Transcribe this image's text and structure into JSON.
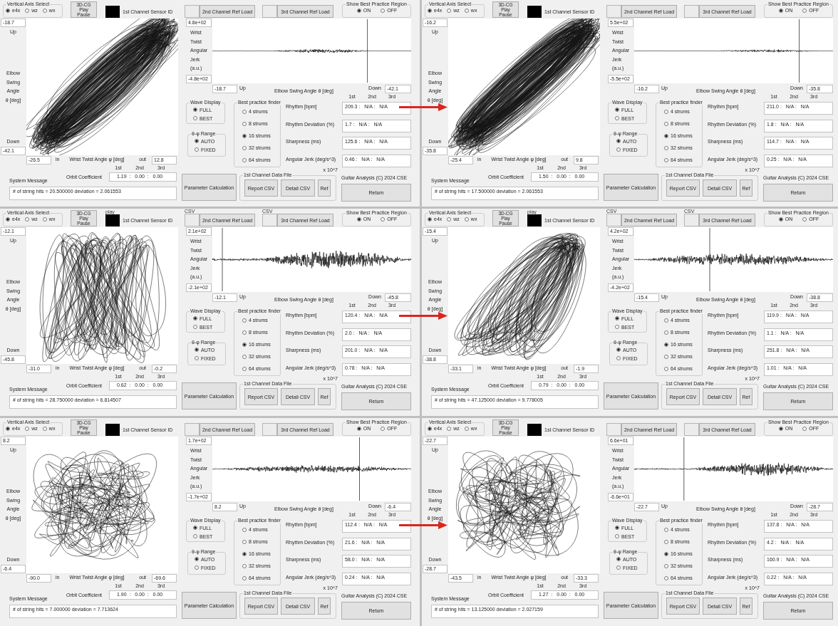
{
  "panels": [
    {
      "axis_select": {
        "title": "Vertical Axis Select",
        "options": [
          {
            "label": "e4x",
            "selected": true
          },
          {
            "label": "wz",
            "selected": false
          },
          {
            "label": "wx",
            "selected": false
          }
        ]
      },
      "play_button": [
        "3D-CG",
        "Play",
        "Pause"
      ],
      "sensor": {
        "label": "1st Channel Sensor ID"
      },
      "ref_loads": [
        {
          "label": "2nd Channel Ref Load"
        },
        {
          "label": "3rd Channel Ref Load"
        }
      ],
      "best_region": {
        "title": "Show Best Practice Region",
        "options": [
          {
            "label": "ON",
            "selected": true
          },
          {
            "label": "OFF",
            "selected": false
          }
        ]
      },
      "orbit_plot": {
        "kind": "ellipse",
        "up_value": "-18.7",
        "up_label": "Up",
        "y_label": [
          "Elbow",
          "Swing",
          "Angle",
          "θ [deg]"
        ],
        "down_label": "Down",
        "down_value": "-42.1",
        "in_value": "-26.5",
        "in_label": "in",
        "x_label": "Wrist Twist Angle φ [deg]",
        "out_label": "out",
        "out_value": "12.8"
      },
      "jerk_plot": {
        "max_value": "4.8e+02",
        "y_label": [
          "Wrist",
          "Twist",
          "Angular",
          "Jerk",
          "(a.u.)"
        ],
        "min_value": "-4.8e+02",
        "up_value": "-18.7",
        "up_label": "Up",
        "x_label": "Elbow Swing Angle θ [deg]",
        "down_label": "Down",
        "down_value": "-42.1"
      },
      "result_headers": [
        "1st",
        "2nd",
        "3rd"
      ],
      "wave_display": {
        "title": "Wave Display",
        "options": [
          {
            "label": "FULL",
            "selected": true
          },
          {
            "label": "BEST",
            "selected": false
          }
        ]
      },
      "range": {
        "title": "θ-φ Range",
        "options": [
          {
            "label": "AUTO",
            "selected": true
          },
          {
            "label": "FIXED",
            "selected": false
          }
        ]
      },
      "finder": {
        "title": "Best practice finder",
        "options": [
          {
            "label": "4 strums",
            "selected": false
          },
          {
            "label": "8 strums",
            "selected": false
          },
          {
            "label": "16 strums",
            "selected": true
          },
          {
            "label": "32 strums",
            "selected": false
          },
          {
            "label": "64 strums",
            "selected": false
          }
        ]
      },
      "results": [
        {
          "label": "Rhythm [bpm]",
          "value": "209.3 :   N/A :   N/A"
        },
        {
          "label": "Rhythm Deviation (%)",
          "value": "1.7 :   N/A :   N/A"
        },
        {
          "label": "Sharpness (ms)",
          "value": "125.6 :   N/A :   N/A"
        },
        {
          "label": "Angular Jerk (deg/s^3)",
          "value": "0.46 :   N/A :   N/A"
        }
      ],
      "jerk_scale": "x 10^7",
      "orbit_coefficient": {
        "headers": [
          "1st",
          "2nd",
          "3rd"
        ],
        "label": "Orbit Coefficient",
        "value": "1.19  :   0.00  :   0.00"
      },
      "system_message": {
        "label": "System Message",
        "text": "# of string hits = 20.500000 deviation = 2.061553"
      },
      "parameter_button": "Parameter Calculation",
      "data_file": {
        "title": "1st Channel Data File",
        "buttons": [
          "Report CSV",
          "Detail CSV",
          "Ref"
        ]
      },
      "copyright": "Guitar Analysis (C) 2024 CSE",
      "return_button": "Return"
    },
    {
      "axis_select": {
        "title": "Vertical Axis Select",
        "options": [
          {
            "label": "e4x",
            "selected": true
          },
          {
            "label": "wz",
            "selected": false
          },
          {
            "label": "wx",
            "selected": false
          }
        ]
      },
      "play_button": [
        "3D-CG",
        "Play",
        "Pause"
      ],
      "sensor": {
        "label": "1st Channel Sensor ID"
      },
      "ref_loads": [
        {
          "label": "2nd Channel Ref Load"
        },
        {
          "label": "3rd Channel Ref Load"
        }
      ],
      "best_region": {
        "title": "Show Best Practice Region",
        "options": [
          {
            "label": "ON",
            "selected": true
          },
          {
            "label": "OFF",
            "selected": false
          }
        ]
      },
      "orbit_plot": {
        "kind": "ellipse",
        "up_value": "-16.2",
        "up_label": "Up",
        "y_label": [
          "Elbow",
          "Swing",
          "Angle",
          "θ [deg]"
        ],
        "down_label": "Down",
        "down_value": "-35.8",
        "in_value": "-25.4",
        "in_label": "in",
        "x_label": "Wrist Twist Angle φ [deg]",
        "out_label": "out",
        "out_value": "9.8"
      },
      "jerk_plot": {
        "max_value": "5.5e+02",
        "y_label": [
          "Wrist",
          "Twist",
          "Angular",
          "Jerk",
          "(a.u.)"
        ],
        "min_value": "-5.5e+02",
        "up_value": "-16.2",
        "up_label": "Up",
        "x_label": "Elbow Swing Angle θ [deg]",
        "down_label": "Down",
        "down_value": "-35.8"
      },
      "result_headers": [
        "1st",
        "2nd",
        "3rd"
      ],
      "wave_display": {
        "title": "Wave Display",
        "options": [
          {
            "label": "FULL",
            "selected": true
          },
          {
            "label": "BEST",
            "selected": false
          }
        ]
      },
      "range": {
        "title": "θ-φ Range",
        "options": [
          {
            "label": "AUTO",
            "selected": true
          },
          {
            "label": "FIXED",
            "selected": false
          }
        ]
      },
      "finder": {
        "title": "Best practice finder",
        "options": [
          {
            "label": "4 strums",
            "selected": false
          },
          {
            "label": "8 strums",
            "selected": false
          },
          {
            "label": "16 strums",
            "selected": true
          },
          {
            "label": "32 strums",
            "selected": false
          },
          {
            "label": "64 strums",
            "selected": false
          }
        ]
      },
      "results": [
        {
          "label": "Rhythm [bpm]",
          "value": "211.0 :   N/A :   N/A"
        },
        {
          "label": "Rhythm Deviation (%)",
          "value": "1.8 :   N/A :   N/A"
        },
        {
          "label": "Sharpness (ms)",
          "value": "114.7 :   N/A :   N/A"
        },
        {
          "label": "Angular Jerk (deg/s^3)",
          "value": "0.25 :   N/A :   N/A"
        }
      ],
      "jerk_scale": "x 10^7",
      "orbit_coefficient": {
        "headers": [
          "1st",
          "2nd",
          "3rd"
        ],
        "label": "Orbit Coefficient",
        "value": "1.50  :   0.00  :   0.00"
      },
      "system_message": {
        "label": "System Message",
        "text": "# of string hits = 17.500000 deviation = 2.061553"
      },
      "parameter_button": "Parameter Calculation",
      "data_file": {
        "title": "1st Channel Data File",
        "buttons": [
          "Report CSV",
          "Detail CSV",
          "Ref"
        ]
      },
      "copyright": "Guitar Analysis (C) 2024 CSE",
      "return_button": "Return"
    },
    {
      "axis_select": {
        "title": "Vertical Axis Select",
        "options": [
          {
            "label": "e4x",
            "selected": true
          },
          {
            "label": "wz",
            "selected": false
          },
          {
            "label": "wx",
            "selected": false
          }
        ]
      },
      "play_button": [
        "3D-CG",
        "Play",
        "Pause"
      ],
      "sensor": {
        "caption": "play",
        "label": "1st Channel Sensor ID"
      },
      "ref_loads": [
        {
          "caption": "CSV",
          "label": "2nd Channel Ref Load"
        },
        {
          "caption": "CSV",
          "label": "3rd Channel Ref Load"
        }
      ],
      "best_region": {
        "title": "Show Best Practice Region",
        "options": [
          {
            "label": "ON",
            "selected": true
          },
          {
            "label": "OFF",
            "selected": false
          }
        ]
      },
      "orbit_plot": {
        "kind": "loops",
        "up_value": "-12.1",
        "up_label": "Up",
        "y_label": [
          "Elbow",
          "Swing",
          "Angle",
          "θ [deg]"
        ],
        "down_label": "Down",
        "down_value": "-45.8",
        "in_value": "-31.0",
        "in_label": "in",
        "x_label": "Wrist Twist Angle φ [deg]",
        "out_label": "out",
        "out_value": "-0.2"
      },
      "jerk_plot": {
        "max_value": "2.1e+02",
        "y_label": [
          "Wrist",
          "Twist",
          "Angular",
          "Jerk",
          "(a.u.)"
        ],
        "min_value": "-2.1e+02",
        "up_value": "-12.1",
        "up_label": "Up",
        "x_label": "Elbow Swing Angle θ [deg]",
        "down_label": "Down",
        "down_value": "-45.8"
      },
      "result_headers": [
        "1st",
        "2nd",
        "3rd"
      ],
      "wave_display": {
        "title": "Wave Display",
        "options": [
          {
            "label": "FULL",
            "selected": true
          },
          {
            "label": "BEST",
            "selected": false
          }
        ]
      },
      "range": {
        "title": "θ-φ Range",
        "options": [
          {
            "label": "AUTO",
            "selected": true
          },
          {
            "label": "FIXED",
            "selected": false
          }
        ]
      },
      "finder": {
        "title": "Best practice finder",
        "options": [
          {
            "label": "4 strums",
            "selected": false
          },
          {
            "label": "8 strums",
            "selected": false
          },
          {
            "label": "16 strums",
            "selected": true
          },
          {
            "label": "32 strums",
            "selected": false
          },
          {
            "label": "64 strums",
            "selected": false
          }
        ]
      },
      "results": [
        {
          "label": "Rhythm [bpm]",
          "value": "120.4 :   N/A :   N/A"
        },
        {
          "label": "Rhythm Deviation (%)",
          "value": "2.0 :   N/A :   N/A"
        },
        {
          "label": "Sharpness (ms)",
          "value": "201.0 :   N/A :   N/A"
        },
        {
          "label": "Angular Jerk (deg/s^3)",
          "value": "0.78 :   N/A :   N/A"
        }
      ],
      "jerk_scale": "x 10^7",
      "orbit_coefficient": {
        "headers": [
          "1st",
          "2nd",
          "3rd"
        ],
        "label": "Orbit Coefficient",
        "value": "0.62  :   0.00  :   0.00"
      },
      "system_message": {
        "label": "System Message",
        "text": "# of string hits = 28.750000 deviation = 6.814507"
      },
      "parameter_button": "Parameter Calculation",
      "data_file": {
        "title": "1st Channel Data File",
        "buttons": [
          "Report CSV",
          "Detail CSV",
          "Ref"
        ]
      },
      "copyright": "Guitar Analysis (C) 2024 CSE",
      "return_button": "Return"
    },
    {
      "axis_select": {
        "title": "Vertical Axis Select",
        "options": [
          {
            "label": "e4x",
            "selected": true
          },
          {
            "label": "wz",
            "selected": false
          },
          {
            "label": "wx",
            "selected": false
          }
        ]
      },
      "play_button": [
        "3D-CG",
        "Play",
        "Pause"
      ],
      "sensor": {
        "caption": "play",
        "label": "1st Channel Sensor ID"
      },
      "ref_loads": [
        {
          "caption": "CSV",
          "label": "2nd Channel Ref Load"
        },
        {
          "caption": "CSV",
          "label": "3rd Channel Ref Load"
        }
      ],
      "best_region": {
        "title": "Show Best Practice Region",
        "options": [
          {
            "label": "ON",
            "selected": true
          },
          {
            "label": "OFF",
            "selected": false
          }
        ]
      },
      "orbit_plot": {
        "kind": "fan",
        "up_value": "-15.4",
        "up_label": "Up",
        "y_label": [
          "Elbow",
          "Swing",
          "Angle",
          "θ [deg]"
        ],
        "down_label": "Down",
        "down_value": "-38.8",
        "in_value": "-33.1",
        "in_label": "in",
        "x_label": "Wrist Twist Angle φ [deg]",
        "out_label": "out",
        "out_value": "-1.9"
      },
      "jerk_plot": {
        "max_value": "4.2e+02",
        "y_label": [
          "Wrist",
          "Twist",
          "Angular",
          "Jerk",
          "(a.u.)"
        ],
        "min_value": "-4.2e+02",
        "up_value": "-15.4",
        "up_label": "Up",
        "x_label": "Elbow Swing Angle θ [deg]",
        "down_label": "Down",
        "down_value": "-38.8"
      },
      "result_headers": [
        "1st",
        "2nd",
        "3rd"
      ],
      "wave_display": {
        "title": "Wave Display",
        "options": [
          {
            "label": "FULL",
            "selected": true
          },
          {
            "label": "BEST",
            "selected": false
          }
        ]
      },
      "range": {
        "title": "θ-φ Range",
        "options": [
          {
            "label": "AUTO",
            "selected": true
          },
          {
            "label": "FIXED",
            "selected": false
          }
        ]
      },
      "finder": {
        "title": "Best practice finder",
        "options": [
          {
            "label": "4 strums",
            "selected": false
          },
          {
            "label": "8 strums",
            "selected": false
          },
          {
            "label": "16 strums",
            "selected": true
          },
          {
            "label": "32 strums",
            "selected": false
          },
          {
            "label": "64 strums",
            "selected": false
          }
        ]
      },
      "results": [
        {
          "label": "Rhythm [bpm]",
          "value": "119.9 :   N/A :   N/A"
        },
        {
          "label": "Rhythm Deviation (%)",
          "value": "1.1 :   N/A :   N/A"
        },
        {
          "label": "Sharpness (ms)",
          "value": "251.8 :   N/A :   N/A"
        },
        {
          "label": "Angular Jerk (deg/s^3)",
          "value": "1.01 :   N/A :   N/A"
        }
      ],
      "jerk_scale": "x 10^7",
      "orbit_coefficient": {
        "headers": [
          "1st",
          "2nd",
          "3rd"
        ],
        "label": "Orbit Coefficient",
        "value": "0.79  :   0.00  :   0.00"
      },
      "system_message": {
        "label": "System Message",
        "text": "# of string hits = 47.125000 deviation = 9.778005"
      },
      "parameter_button": "Parameter Calculation",
      "data_file": {
        "title": "1st Channel Data File",
        "buttons": [
          "Report CSV",
          "Detail CSV",
          "Ref"
        ]
      },
      "copyright": "Guitar Analysis (C) 2024 CSE",
      "return_button": "Return"
    },
    {
      "axis_select": {
        "title": "Vertical Axis Select",
        "options": [
          {
            "label": "e4x",
            "selected": true
          },
          {
            "label": "wz",
            "selected": false
          },
          {
            "label": "wx",
            "selected": false
          }
        ]
      },
      "play_button": [
        "3D-CG",
        "Play",
        "Pause"
      ],
      "sensor": {
        "label": "1st Channel Sensor ID"
      },
      "ref_loads": [
        {
          "label": "2nd Channel Ref Load"
        },
        {
          "label": "3rd Channel Ref Load"
        }
      ],
      "best_region": {
        "title": "Show Best Practice Region",
        "options": [
          {
            "label": "ON",
            "selected": true
          },
          {
            "label": "OFF",
            "selected": false
          }
        ]
      },
      "orbit_plot": {
        "kind": "tangle",
        "up_value": "8.2",
        "up_label": "Up",
        "y_label": [
          "Elbow",
          "Swing",
          "Angle",
          "θ [deg]"
        ],
        "down_label": "Down",
        "down_value": "-6.4",
        "in_value": "-90.0",
        "in_label": "in",
        "x_label": "Wrist Twist Angle φ [deg]",
        "out_label": "out",
        "out_value": "-69.6"
      },
      "jerk_plot": {
        "max_value": "1.7e+02",
        "y_label": [
          "Wrist",
          "Twist",
          "Angular",
          "Jerk",
          "(a.u.)"
        ],
        "min_value": "-1.7e+02",
        "up_value": "8.2",
        "up_label": "Up",
        "x_label": "Elbow Swing Angle θ [deg]",
        "down_label": "Down",
        "down_value": "-6.4"
      },
      "result_headers": [
        "1st",
        "2nd",
        "3rd"
      ],
      "wave_display": {
        "title": "Wave Display",
        "options": [
          {
            "label": "FULL",
            "selected": true
          },
          {
            "label": "BEST",
            "selected": false
          }
        ]
      },
      "range": {
        "title": "θ-φ Range",
        "options": [
          {
            "label": "AUTO",
            "selected": true
          },
          {
            "label": "FIXED",
            "selected": false
          }
        ]
      },
      "finder": {
        "title": "Best practice finder",
        "options": [
          {
            "label": "4 strums",
            "selected": false
          },
          {
            "label": "8 strums",
            "selected": false
          },
          {
            "label": "16 strums",
            "selected": true
          },
          {
            "label": "32 strums",
            "selected": false
          },
          {
            "label": "64 strums",
            "selected": false
          }
        ]
      },
      "results": [
        {
          "label": "Rhythm [bpm]",
          "value": "112.4 :   N/A :   N/A"
        },
        {
          "label": "Rhythm Deviation (%)",
          "value": "21.6 :   N/A :   N/A"
        },
        {
          "label": "Sharpness (ms)",
          "value": "58.0 :   N/A :   N/A"
        },
        {
          "label": "Angular Jerk (deg/s^3)",
          "value": "0.24 :   N/A :   N/A"
        }
      ],
      "jerk_scale": "x 10^7",
      "orbit_coefficient": {
        "headers": [
          "1st",
          "2nd",
          "3rd"
        ],
        "label": "Orbit Coefficient",
        "value": "1.90  :   0.00  :   0.00"
      },
      "system_message": {
        "label": "System Message",
        "text": "# of string hits = 7.000000 deviation = 7.713624"
      },
      "parameter_button": "Parameter Calculation",
      "data_file": {
        "title": "1st Channel Data File",
        "buttons": [
          "Report CSV",
          "Detail CSV",
          "Ref"
        ]
      },
      "copyright": "Guitar Analysis (C) 2024 CSE",
      "return_button": "Return"
    },
    {
      "axis_select": {
        "title": "Vertical Axis Select",
        "options": [
          {
            "label": "e4x",
            "selected": true
          },
          {
            "label": "wz",
            "selected": false
          },
          {
            "label": "wx",
            "selected": false
          }
        ]
      },
      "play_button": [
        "3D-CG",
        "Play",
        "Pause"
      ],
      "sensor": {
        "label": "1st Channel Sensor ID"
      },
      "ref_loads": [
        {
          "label": "2nd Channel Ref Load"
        },
        {
          "label": "3rd Channel Ref Load"
        }
      ],
      "best_region": {
        "title": "Show Best Practice Region",
        "options": [
          {
            "label": "ON",
            "selected": true
          },
          {
            "label": "OFF",
            "selected": false
          }
        ]
      },
      "orbit_plot": {
        "kind": "tangle",
        "up_value": "-22.7",
        "up_label": "Up",
        "y_label": [
          "Elbow",
          "Swing",
          "Angle",
          "θ [deg]"
        ],
        "down_label": "Down",
        "down_value": "-28.7",
        "in_value": "-43.5",
        "in_label": "in",
        "x_label": "Wrist Twist Angle φ [deg]",
        "out_label": "out",
        "out_value": "-33.3"
      },
      "jerk_plot": {
        "max_value": "6.6e+01",
        "y_label": [
          "Wrist",
          "Twist",
          "Angular",
          "Jerk",
          "(a.u.)"
        ],
        "min_value": "-6.6e+01",
        "up_value": "-22.7",
        "up_label": "Up",
        "x_label": "Elbow Swing Angle θ [deg]",
        "down_label": "Down",
        "down_value": "-28.7"
      },
      "result_headers": [
        "1st",
        "2nd",
        "3rd"
      ],
      "wave_display": {
        "title": "Wave Display",
        "options": [
          {
            "label": "FULL",
            "selected": true
          },
          {
            "label": "BEST",
            "selected": false
          }
        ]
      },
      "range": {
        "title": "θ-φ Range",
        "options": [
          {
            "label": "AUTO",
            "selected": true
          },
          {
            "label": "FIXED",
            "selected": false
          }
        ]
      },
      "finder": {
        "title": "Best practice finder",
        "options": [
          {
            "label": "4 strums",
            "selected": false
          },
          {
            "label": "8 strums",
            "selected": false
          },
          {
            "label": "16 strums",
            "selected": true
          },
          {
            "label": "32 strums",
            "selected": false
          },
          {
            "label": "64 strums",
            "selected": false
          }
        ]
      },
      "results": [
        {
          "label": "Rhythm [bpm]",
          "value": "137.8 :   N/A :   N/A"
        },
        {
          "label": "Rhythm Deviation (%)",
          "value": "4.2 :   N/A :   N/A"
        },
        {
          "label": "Sharpness (ms)",
          "value": "160.9 :   N/A :   N/A"
        },
        {
          "label": "Angular Jerk (deg/s^3)",
          "value": "0.22 :   N/A :   N/A"
        }
      ],
      "jerk_scale": "x 10^7",
      "orbit_coefficient": {
        "headers": [
          "1st",
          "2nd",
          "3rd"
        ],
        "label": "Orbit Coefficient",
        "value": "1.27  :   0.00  :   0.00"
      },
      "system_message": {
        "label": "System Message",
        "text": "# of string hits = 13.125000 deviation = 2.027159"
      },
      "parameter_button": "Parameter Calculation",
      "data_file": {
        "title": "1st Channel Data File",
        "buttons": [
          "Report CSV",
          "Detail CSV",
          "Ref"
        ]
      },
      "copyright": "Guitar Analysis (C) 2024 CSE",
      "return_button": "Return"
    }
  ]
}
